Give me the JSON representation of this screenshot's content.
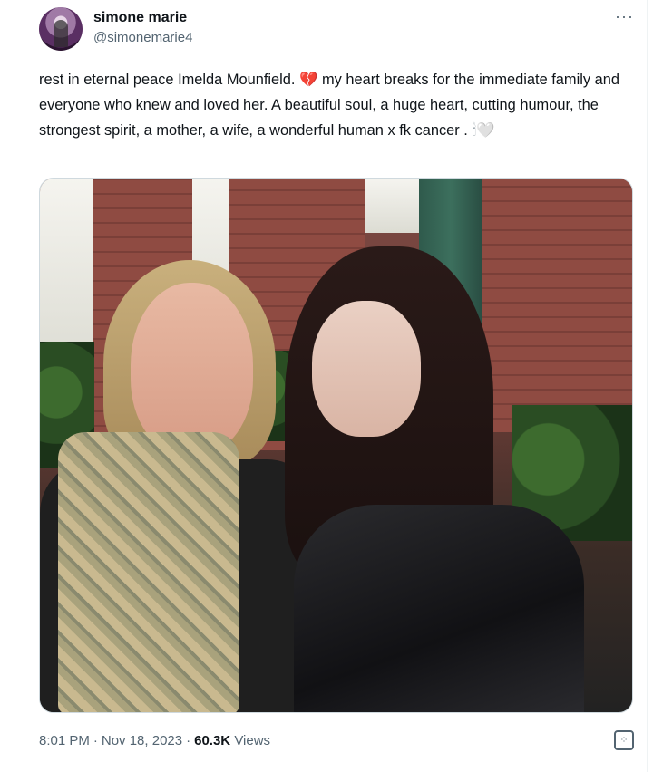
{
  "tweet": {
    "author": {
      "display_name": "simone marie",
      "handle": "@simonemarie4"
    },
    "more_icon": "more-horizontal-icon",
    "text_before_emoji": "rest in eternal peace Imelda Mounfield.",
    "emoji_broken_heart": "💔",
    "text_after_emoji": "my heart breaks for the immediate family and everyone who knew and loved her. A beautiful soul, a huge heart, cutting humour, the strongest spirit, a mother, a wife, a wonderful human x fk cancer .",
    "emoji_candle": "🕯",
    "emoji_white_heart": "🤍",
    "photo_present": true,
    "meta": {
      "time": "8:01 PM",
      "date": "Nov 18, 2023",
      "separator": "·",
      "views_count": "60.3K",
      "views_label": "Views"
    },
    "grok_icon": "grok-icon"
  },
  "colors": {
    "text": "#0f1419",
    "secondary": "#536471",
    "border": "#cfd9de",
    "broken_heart": "#b52d3a"
  }
}
